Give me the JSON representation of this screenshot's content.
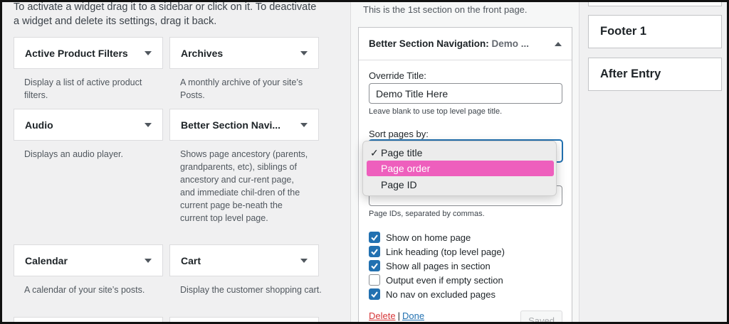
{
  "intro_text": "To activate a widget drag it to a sidebar or click on it. To deactivate a widget and delete its settings, drag it back.",
  "widgets": [
    {
      "title": "Active Product Filters",
      "desc": "Display a list of active product filters."
    },
    {
      "title": "Archives",
      "desc": "A monthly archive of your site’s Posts."
    },
    {
      "title": "Audio",
      "desc": "Displays an audio player."
    },
    {
      "title": "Better Section Navi...",
      "desc": "Shows page ancestory (parents, grandparents, etc), siblings of ancestory and cur-rent page, and immediate chil-dren of the current page be-neath the current top level page."
    },
    {
      "title": "Calendar",
      "desc": "A calendar of your site’s posts."
    },
    {
      "title": "Cart",
      "desc": "Display the customer shopping cart."
    }
  ],
  "section": {
    "description": "This is the 1st section on the front page."
  },
  "panel": {
    "title": "Better Section Navigation:",
    "title_sub": "Demo ...",
    "override_label": "Override Title:",
    "override_value": "Demo Title Here",
    "override_help": "Leave blank to use top level page title.",
    "sort_label": "Sort pages by:",
    "sort_options": [
      "Page title",
      "Page order",
      "Page ID"
    ],
    "sort_checkmark": "✓",
    "exclude_help": "Page IDs, separated by commas.",
    "checkboxes": [
      {
        "label": "Show on home page",
        "checked": true
      },
      {
        "label": "Link heading (top level page)",
        "checked": true
      },
      {
        "label": "Show all pages in section",
        "checked": true
      },
      {
        "label": "Output even if empty section",
        "checked": false
      },
      {
        "label": "No nav on excluded pages",
        "checked": true
      }
    ],
    "delete_label": "Delete",
    "separator": "|",
    "done_label": "Done",
    "saved_label": "Saved"
  },
  "sidebars": [
    "Footer 1",
    "After Entry"
  ],
  "colors": {
    "highlight": "#ee5fbd",
    "link": "#2271b1",
    "danger": "#d63638"
  }
}
